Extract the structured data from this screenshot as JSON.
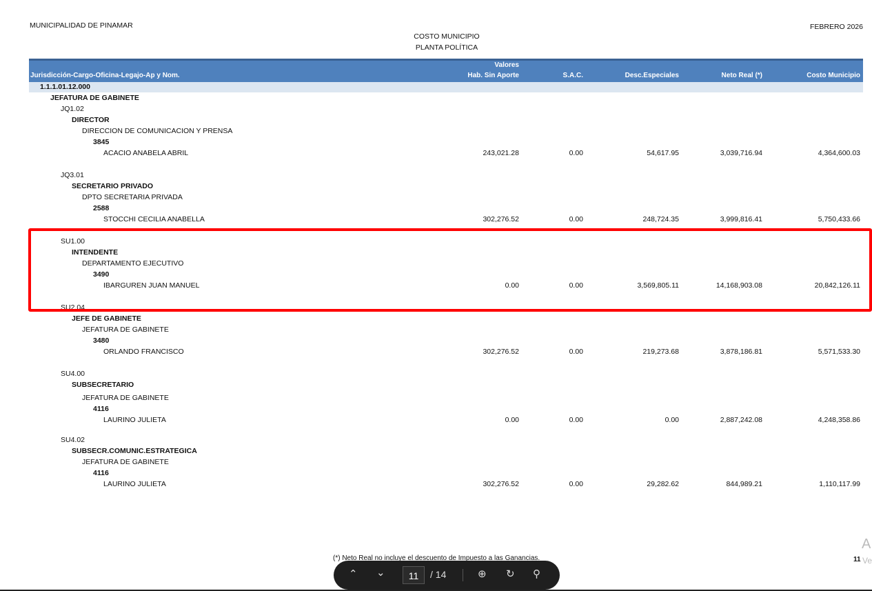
{
  "header": {
    "org": "MUNICIPALIDAD DE PINAMAR",
    "title1": "COSTO MUNICIPIO",
    "title2": "PLANTA POLÍTICA",
    "period": "FEBRERO 2026"
  },
  "columns": {
    "desc": "Jurisdicción-Cargo-Oficina-Legajo-Ap y Nom.",
    "valores": "Valores",
    "hab": "Hab. Sin Aporte",
    "sac": "S.A.C.",
    "desc_esp": "Desc.Especiales",
    "neto": "Neto Real (*)",
    "costo": "Costo Municipio"
  },
  "code": "1.1.1.01.12.000",
  "jurisdiction": "JEFATURA DE GABINETE",
  "groups": [
    {
      "code": "JQ1.02",
      "cargo": "DIRECTOR",
      "oficina": "DIRECCION DE COMUNICACION Y PRENSA",
      "legajo": "3845",
      "nombre": "ACACIO ANABELA ABRIL",
      "hab": "243,021.28",
      "sac": "0.00",
      "desc": "54,617.95",
      "neto": "3,039,716.94",
      "costo": "4,364,600.03"
    },
    {
      "code": "JQ3.01",
      "cargo": "SECRETARIO PRIVADO",
      "oficina": "DPTO SECRETARIA PRIVADA",
      "legajo": "2588",
      "nombre": "STOCCHI CECILIA ANABELLA",
      "hab": "302,276.52",
      "sac": "0.00",
      "desc": "248,724.35",
      "neto": "3,999,816.41",
      "costo": "5,750,433.66"
    },
    {
      "code": "SU1.00",
      "cargo": "INTENDENTE",
      "oficina": "DEPARTAMENTO EJECUTIVO",
      "legajo": "3490",
      "nombre": "IBARGUREN JUAN MANUEL",
      "hab": "0.00",
      "sac": "0.00",
      "desc": "3,569,805.11",
      "neto": "14,168,903.08",
      "costo": "20,842,126.11"
    },
    {
      "code": "SU2.04",
      "cargo": "JEFE DE GABINETE",
      "oficina": "JEFATURA DE GABINETE",
      "legajo": "3480",
      "nombre": "ORLANDO FRANCISCO",
      "hab": "302,276.52",
      "sac": "0.00",
      "desc": "219,273.68",
      "neto": "3,878,186.81",
      "costo": "5,571,533.30"
    },
    {
      "code": "SU4.00",
      "cargo": "SUBSECRETARIO",
      "oficina": "JEFATURA DE GABINETE",
      "legajo": "4116",
      "nombre": "LAURINO JULIETA",
      "hab": "0.00",
      "sac": "0.00",
      "desc": "0.00",
      "neto": "2,887,242.08",
      "costo": "4,248,358.86"
    },
    {
      "code": "SU4.02",
      "cargo": "SUBSECR.COMUNIC.ESTRATEGICA",
      "oficina": "JEFATURA DE GABINETE",
      "legajo": "4116",
      "nombre": "LAURINO JULIETA",
      "hab": "302,276.52",
      "sac": "0.00",
      "desc": "29,282.62",
      "neto": "844,989.21",
      "costo": "1,110,117.99"
    }
  ],
  "footer": {
    "note": "(*) Neto Real no incluye el descuento de Impuesto a las Ganancias.",
    "page_num": "11"
  },
  "toolbar": {
    "current_page": "11",
    "total": "/ 14"
  },
  "overlay": {
    "letter": "A",
    "sub": "Ve"
  }
}
